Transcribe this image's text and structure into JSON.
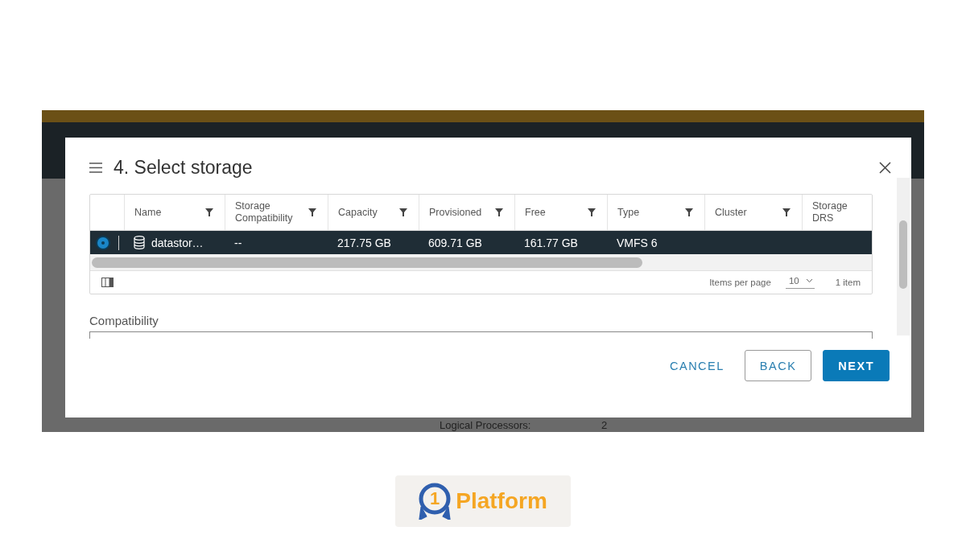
{
  "background": {
    "field_label": "Logical Processors:",
    "field_value": "2"
  },
  "dialog": {
    "title": "4. Select storage",
    "table": {
      "columns": [
        {
          "label": "Name",
          "filterable": true
        },
        {
          "label": "Storage Compatibility",
          "filterable": true
        },
        {
          "label": "Capacity",
          "filterable": true
        },
        {
          "label": "Provisioned",
          "filterable": true
        },
        {
          "label": "Free",
          "filterable": true
        },
        {
          "label": "Type",
          "filterable": true
        },
        {
          "label": "Cluster",
          "filterable": true
        },
        {
          "label": "Storage DRS",
          "filterable": false
        }
      ],
      "rows": [
        {
          "selected": true,
          "cells": [
            "datastor…",
            "--",
            "217.75 GB",
            "609.71 GB",
            "161.77 GB",
            "VMFS 6"
          ]
        }
      ],
      "footer": {
        "items_per_page_label": "Items per page",
        "items_per_page": "10",
        "count": "1 item"
      }
    },
    "compatibility_label": "Compatibility",
    "buttons": [
      {
        "kind": "link",
        "label": "CANCEL"
      },
      {
        "kind": "outline",
        "label": "BACK"
      },
      {
        "kind": "primary",
        "label": "NEXT"
      }
    ]
  },
  "logo": {
    "badge": "1",
    "text": "Platform"
  }
}
